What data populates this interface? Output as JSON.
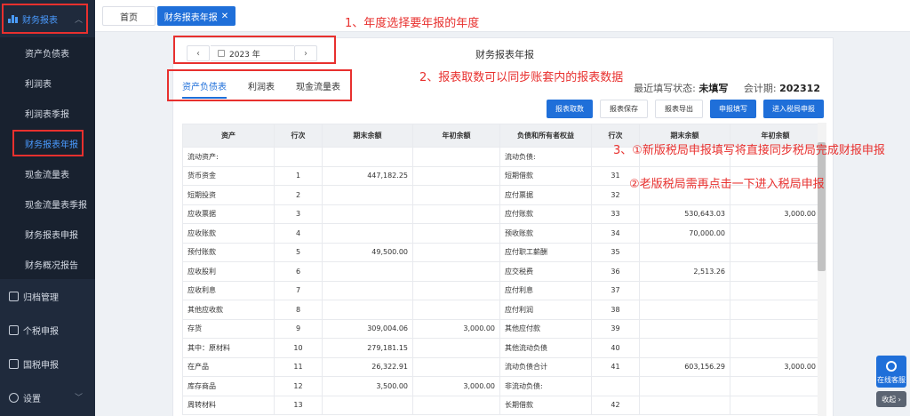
{
  "sidebar": {
    "group_label": "财务报表",
    "sub_items": [
      "资产负债表",
      "利润表",
      "利润表季报",
      "财务报表年报",
      "现金流量表",
      "现金流量表季报",
      "财务报表申报",
      "财务概况报告"
    ],
    "main_items": [
      "归档管理",
      "个税申报",
      "国税申报",
      "设置"
    ]
  },
  "tabs": {
    "home": "首页",
    "current": "财务报表年报",
    "close": "✕"
  },
  "year": {
    "prev": "‹",
    "value": "2023 年",
    "next": "›"
  },
  "card_title": "财务报表年报",
  "sub_tabs": [
    "资产负债表",
    "利润表",
    "现金流量表"
  ],
  "status": {
    "fill_label": "最近填写状态:",
    "fill_value": "未填写",
    "period_label": "会计期:",
    "period_value": "202312"
  },
  "buttons": [
    "报表取数",
    "报表保存",
    "报表导出",
    "申报填写",
    "进入税局申报"
  ],
  "table": {
    "headers": [
      "资产",
      "行次",
      "期末余额",
      "年初余额",
      "负债和所有者权益",
      "行次",
      "期末余额",
      "年初余额"
    ],
    "rows": [
      [
        "流动资产:",
        "",
        "",
        "",
        "流动负债:",
        "",
        "",
        ""
      ],
      [
        "货币资金",
        "1",
        "447,182.25",
        "",
        "短期借款",
        "31",
        "",
        ""
      ],
      [
        "短期投资",
        "2",
        "",
        "",
        "应付票据",
        "32",
        "",
        ""
      ],
      [
        "应收票据",
        "3",
        "",
        "",
        "应付账款",
        "33",
        "530,643.03",
        "3,000.00"
      ],
      [
        "应收账款",
        "4",
        "",
        "",
        "预收账款",
        "34",
        "70,000.00",
        ""
      ],
      [
        "预付账款",
        "5",
        "49,500.00",
        "",
        "应付职工薪酬",
        "35",
        "",
        ""
      ],
      [
        "应收股利",
        "6",
        "",
        "",
        "应交税费",
        "36",
        "2,513.26",
        ""
      ],
      [
        "应收利息",
        "7",
        "",
        "",
        "应付利息",
        "37",
        "",
        ""
      ],
      [
        "其他应收款",
        "8",
        "",
        "",
        "应付利润",
        "38",
        "",
        ""
      ],
      [
        "存货",
        "9",
        "309,004.06",
        "3,000.00",
        "其他应付款",
        "39",
        "",
        ""
      ],
      [
        "其中：原材料",
        "10",
        "279,181.15",
        "",
        "其他流动负债",
        "40",
        "",
        ""
      ],
      [
        "在产品",
        "11",
        "26,322.91",
        "",
        "流动负债合计",
        "41",
        "603,156.29",
        "3,000.00"
      ],
      [
        "库存商品",
        "12",
        "3,500.00",
        "3,000.00",
        "非流动负债:",
        "",
        "",
        ""
      ],
      [
        "周转材料",
        "13",
        "",
        "",
        "长期借款",
        "42",
        "",
        ""
      ]
    ]
  },
  "annotations": {
    "a1": "1、年度选择要年报的年度",
    "a2": "2、报表取数可以同步账套内的报表数据",
    "a3": "3、①新版税局申报填写将直接同步税局完成财报申报",
    "a4": "②老版税局需再点击一下进入税局申报"
  },
  "widgets": {
    "chat": "在线客服",
    "collapse": "收起 ›"
  }
}
